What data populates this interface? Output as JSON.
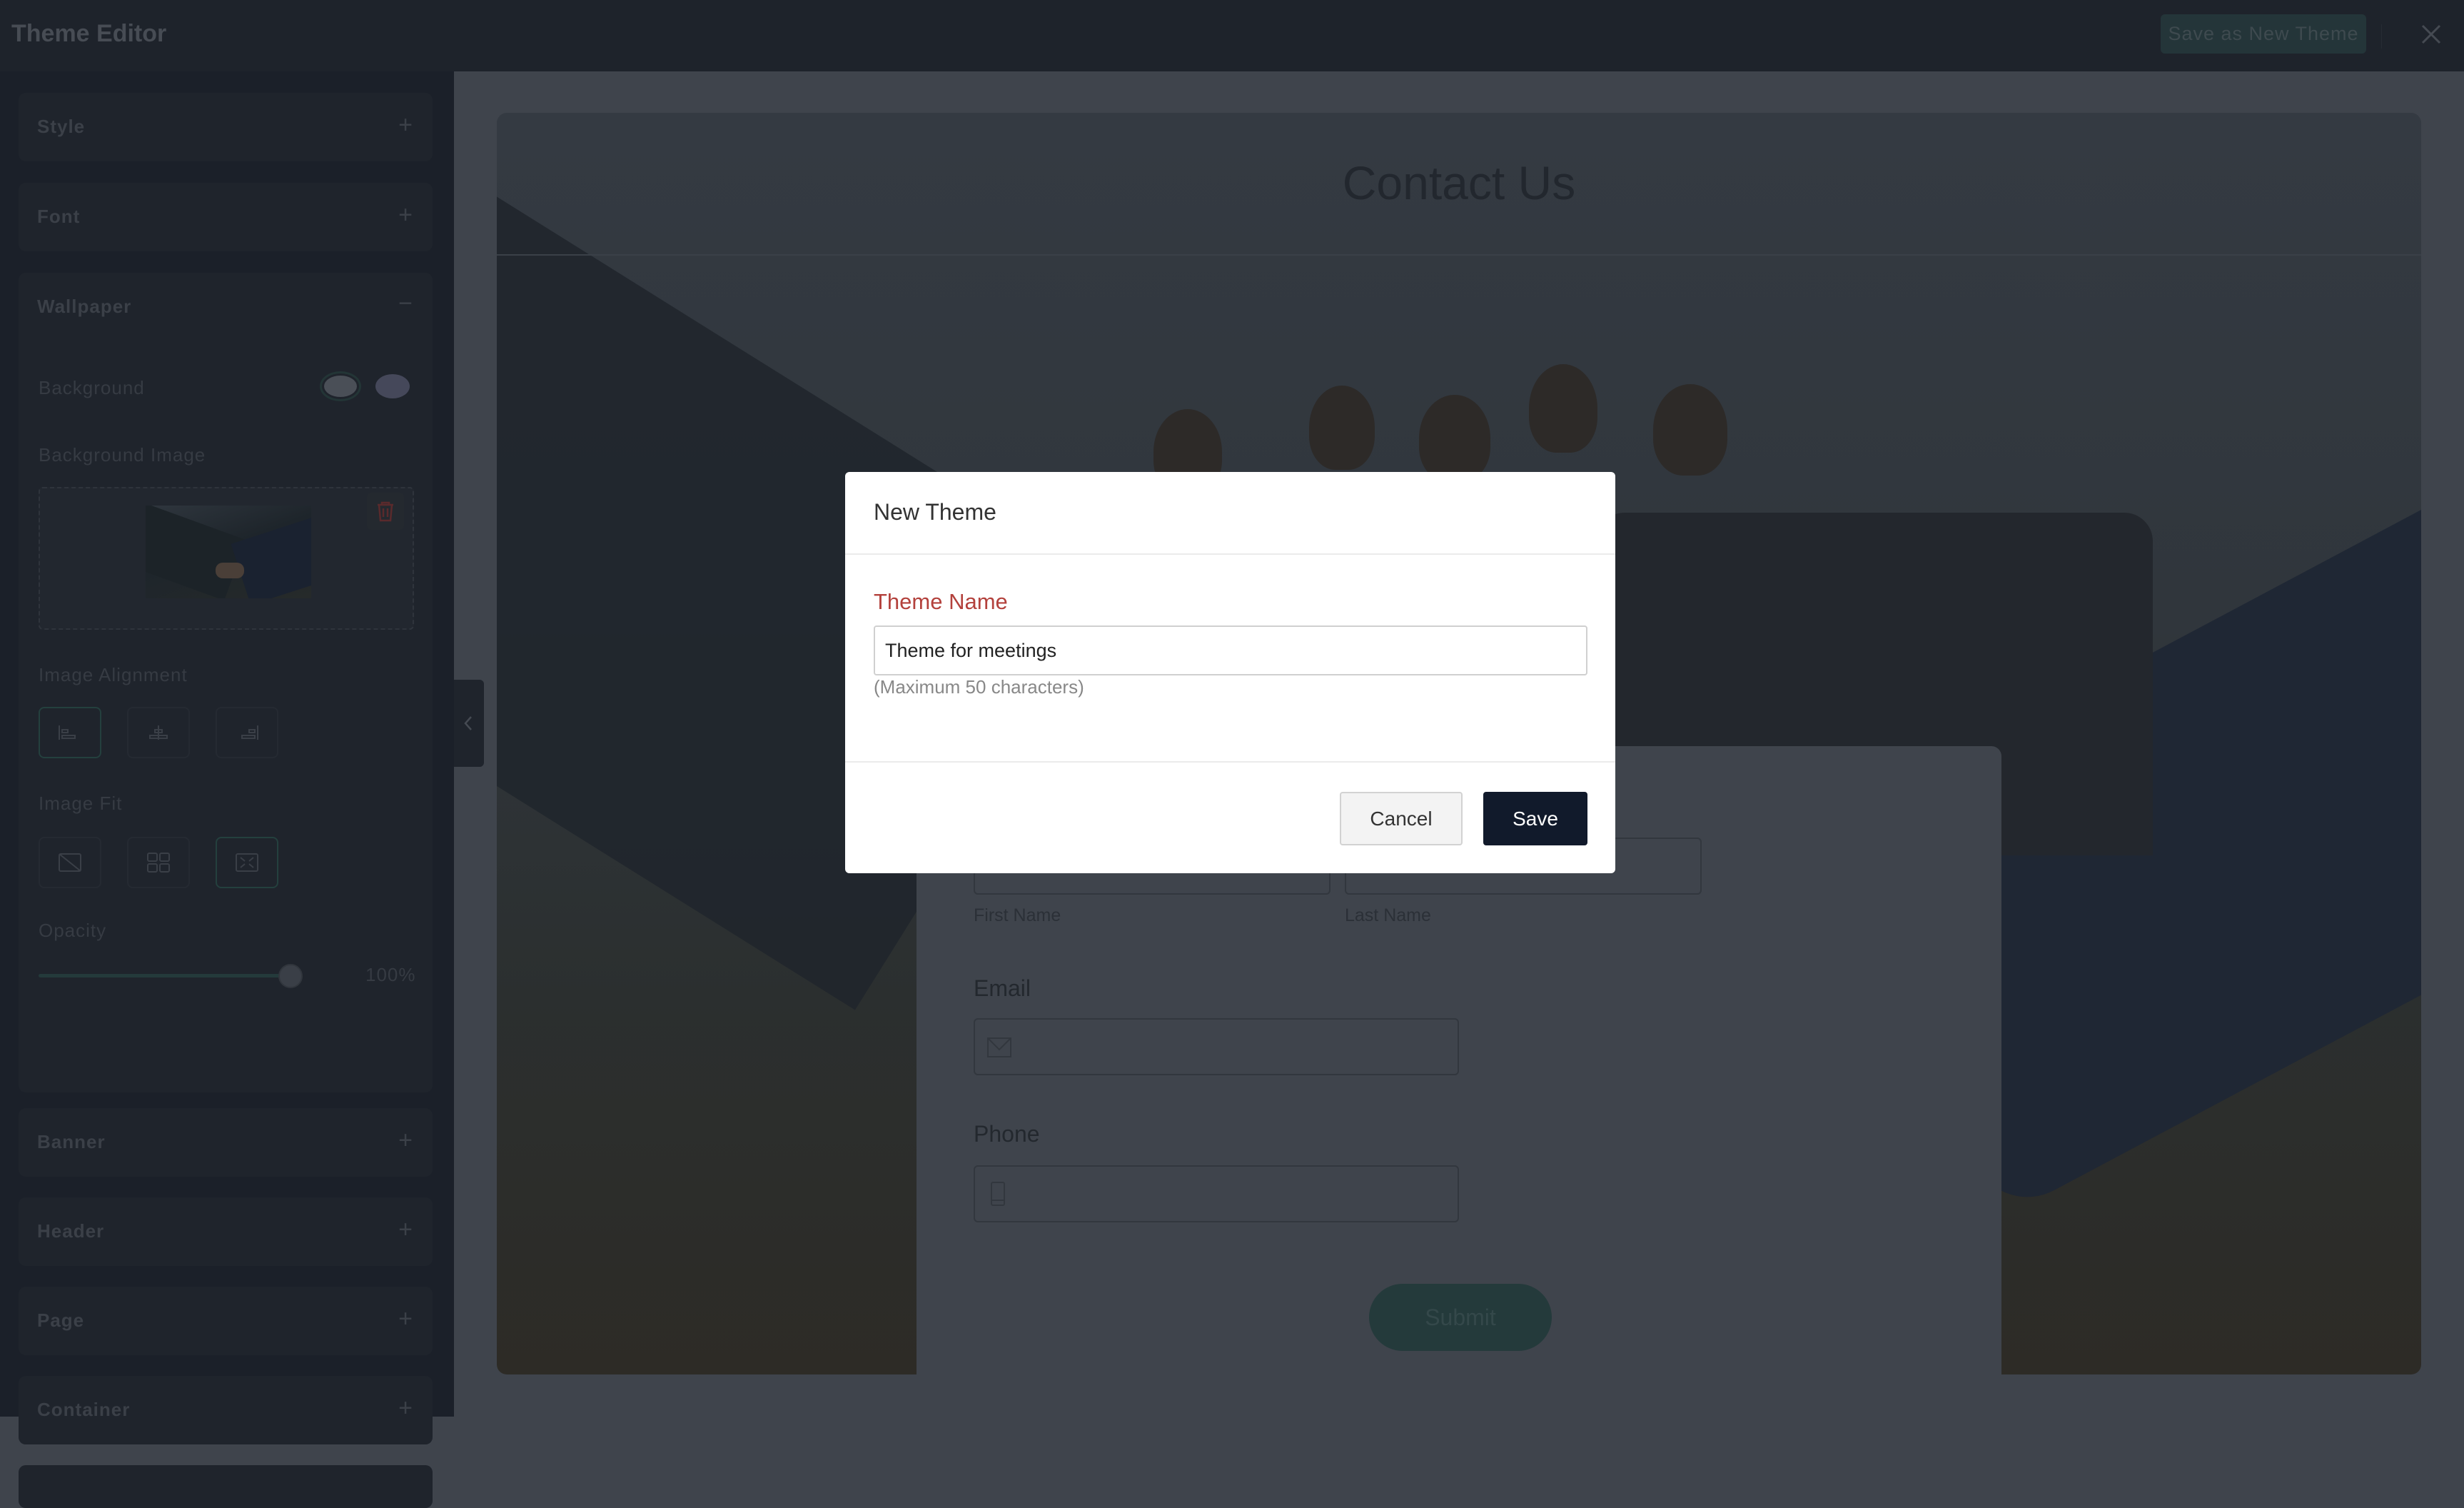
{
  "app": {
    "title": "Theme Editor",
    "save_as_new_label": "Save as New Theme",
    "close_icon": "close-icon"
  },
  "sidebar": {
    "sections": [
      {
        "label": "Style",
        "state": "collapsed"
      },
      {
        "label": "Font",
        "state": "collapsed"
      },
      {
        "label": "Wallpaper",
        "state": "expanded"
      },
      {
        "label": "Banner",
        "state": "collapsed"
      },
      {
        "label": "Header",
        "state": "collapsed"
      },
      {
        "label": "Page",
        "state": "collapsed"
      },
      {
        "label": "Container",
        "state": "collapsed"
      }
    ],
    "wallpaper": {
      "background_label": "Background",
      "background_swatches": [
        "#4a4f57",
        "#45485a"
      ],
      "background_image_label": "Background Image",
      "image_alignment_label": "Image Alignment",
      "image_alignment_options": [
        "align-left",
        "align-center",
        "align-right"
      ],
      "image_alignment_selected": "align-left",
      "image_fit_label": "Image Fit",
      "image_fit_options": [
        "none",
        "tile",
        "cover"
      ],
      "image_fit_selected": "cover",
      "opacity_label": "Opacity",
      "opacity_value": "100%",
      "opacity_percent": 100
    }
  },
  "preview": {
    "title": "Contact Us",
    "first_name_label": "First Name",
    "last_name_label": "Last Name",
    "email_label": "Email",
    "phone_label": "Phone",
    "submit_label": "Submit"
  },
  "modal": {
    "title": "New Theme",
    "field_label": "Theme Name",
    "field_value": "Theme for meetings",
    "hint": "(Maximum 50 characters)",
    "cancel_label": "Cancel",
    "save_label": "Save",
    "label_color": "#b3413c",
    "save_color": "#111a2b"
  }
}
